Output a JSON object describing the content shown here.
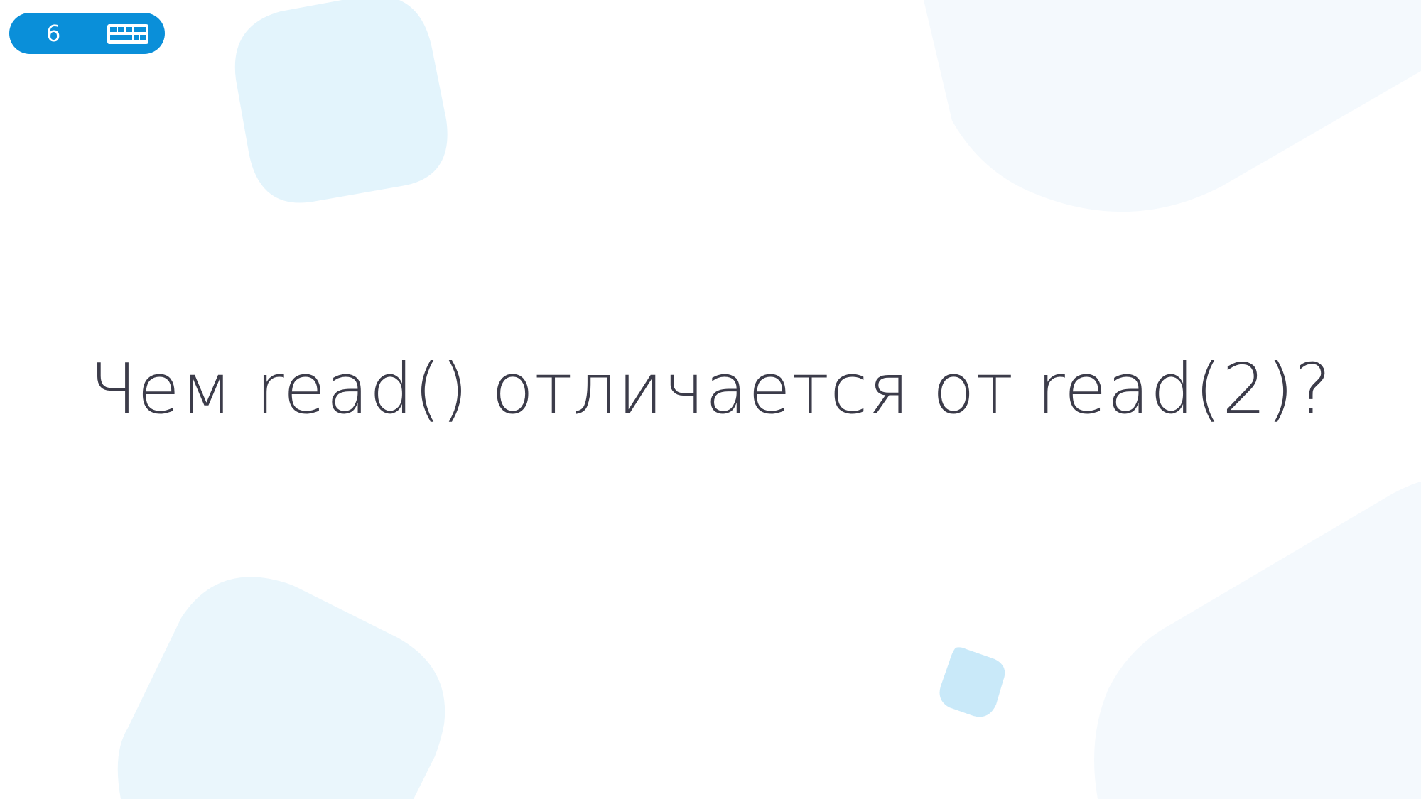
{
  "slide": {
    "number": "6",
    "question": "Чем read() отличается от read(2)?"
  },
  "icons": {
    "keyboard": "keyboard-icon"
  },
  "colors": {
    "accent": "#0a8fd9",
    "text": "#3c3c4a",
    "deco_light": "#e3f4fc",
    "deco_lighter": "#f4f9fd",
    "deco_mid": "#c9e9f9"
  }
}
